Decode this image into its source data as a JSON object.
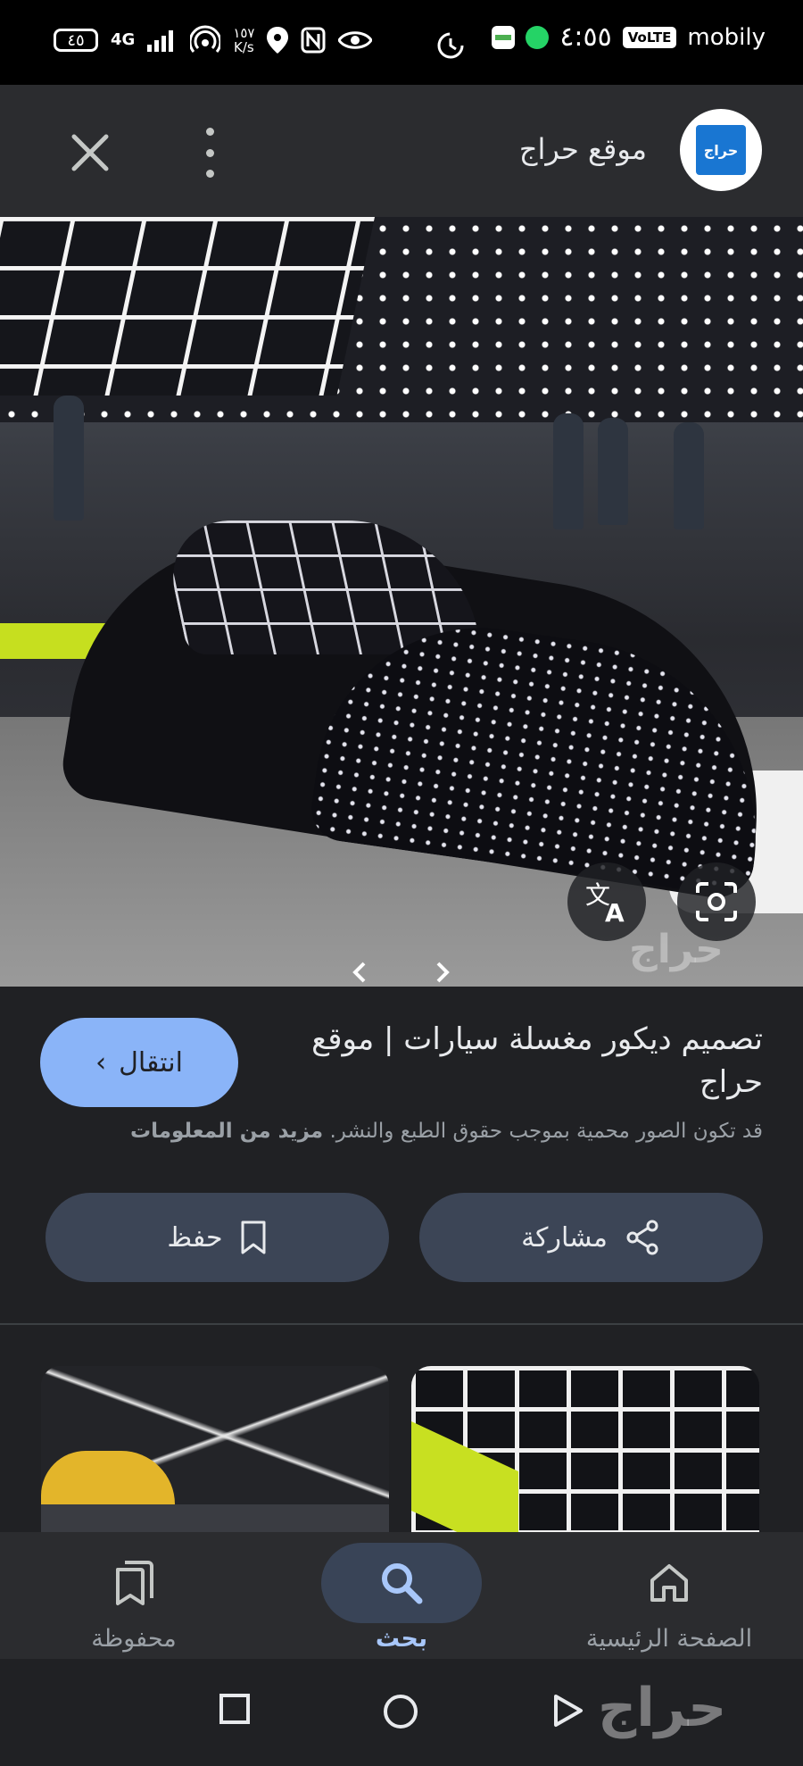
{
  "status_bar": {
    "battery": "٤٥",
    "network": "4G",
    "speed_value": "١٥٧",
    "speed_unit": "K/s",
    "time": "٤:٥٥",
    "volte": "VoLTE",
    "carrier": "mobily"
  },
  "header": {
    "site_name": "موقع حراج",
    "logo_text": "حراج"
  },
  "hero": {
    "watermark": "حراج"
  },
  "result": {
    "title": "تصميم ديكور مغسلة سيارات | موقع حراج",
    "visit_label": "انتقال",
    "copyright_text": "قد تكون الصور محمية بموجب حقوق الطبع والنشر.",
    "more_info_label": "مزيد من المعلومات"
  },
  "actions": {
    "share_label": "مشاركة",
    "save_label": "حفظ"
  },
  "bottom_nav": {
    "saved_label": "محفوظة",
    "search_label": "بحث",
    "home_label": "الصفحة الرئيسية"
  },
  "system_nav": {
    "watermark": "حراج"
  },
  "colors": {
    "background": "#202124",
    "accent": "#8ab4f8",
    "button_fill": "#3c4556",
    "active_nav": "#a8c7fa"
  },
  "icons": [
    "close-icon",
    "more-vert-icon",
    "translate-icon",
    "lens-icon",
    "share-icon",
    "bookmark-icon",
    "saved-collections-icon",
    "search-icon",
    "home-icon",
    "square-icon",
    "circle-icon",
    "back-triangle-icon"
  ]
}
